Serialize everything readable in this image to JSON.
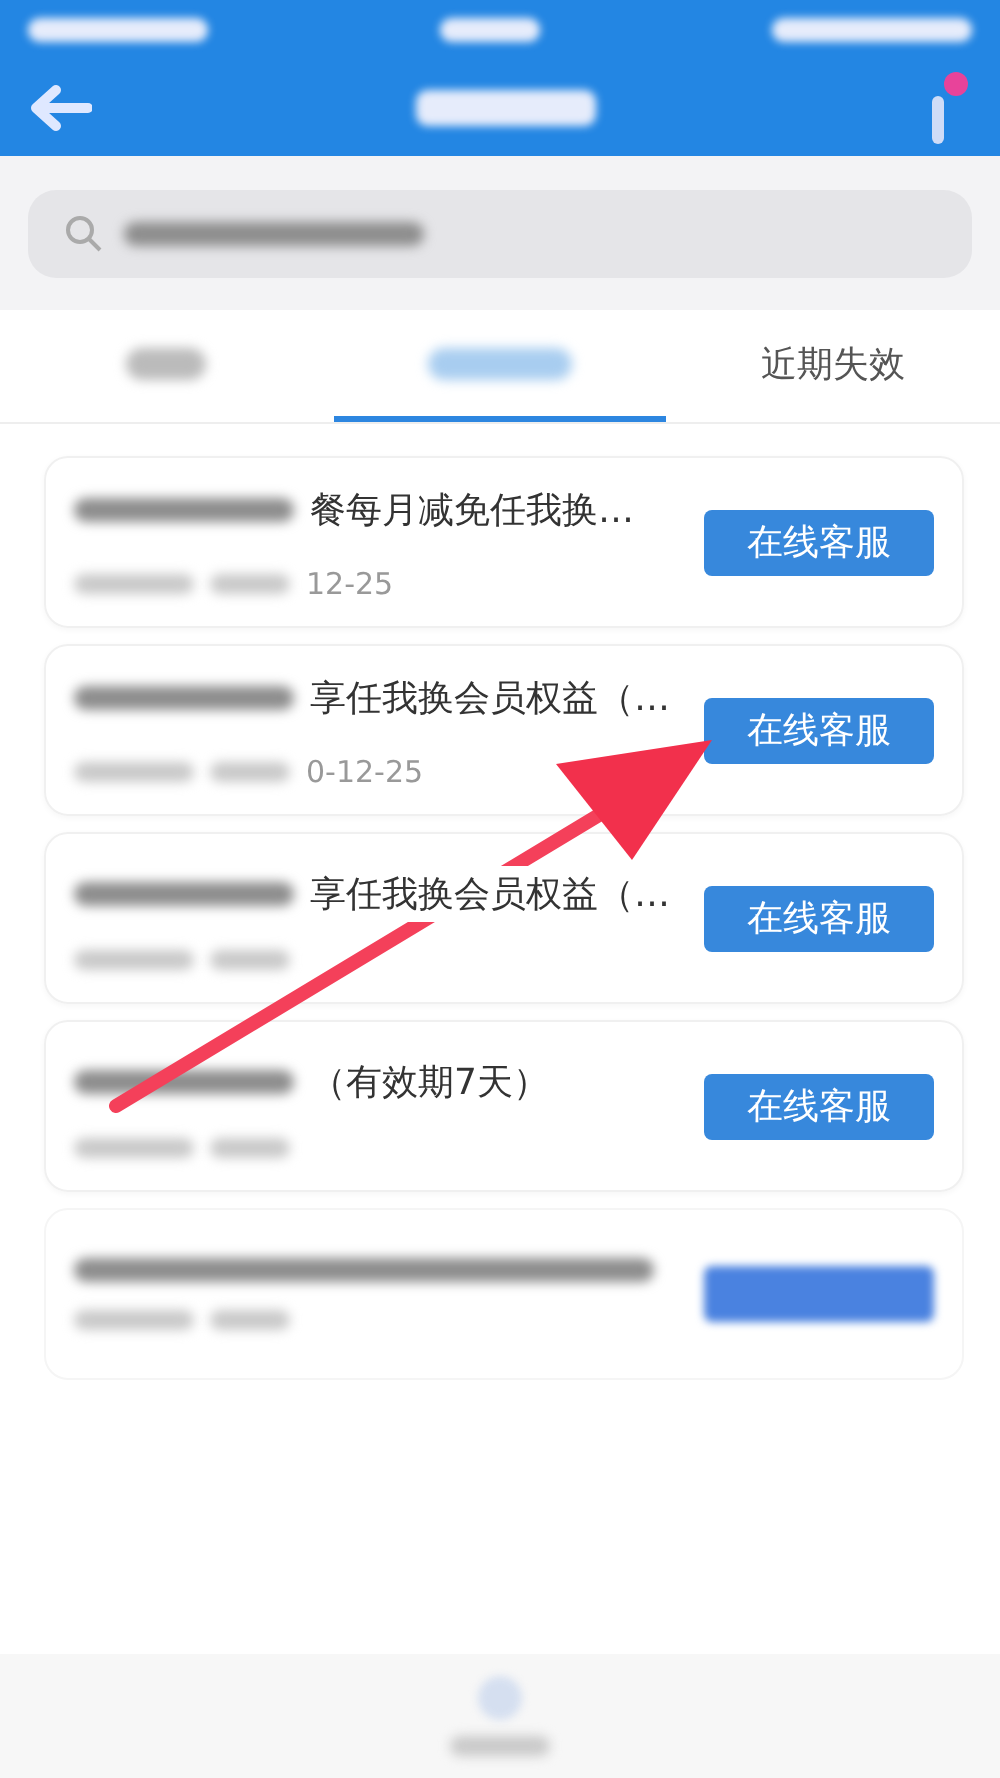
{
  "tabs": [
    {
      "selected": false
    },
    {
      "selected": true
    },
    {
      "label": "近期失效",
      "selected": false
    }
  ],
  "items": [
    {
      "title": "餐每月减免任我换…",
      "date": "12-25",
      "button": "在线客服"
    },
    {
      "title": "享任我换会员权益（…",
      "date": "0-12-25",
      "button": "在线客服"
    },
    {
      "title": "享任我换会员权益（…",
      "button": "在线客服"
    },
    {
      "title": "（有效期7天）",
      "button": "在线客服"
    },
    {
      "kind": "blurred"
    }
  ]
}
